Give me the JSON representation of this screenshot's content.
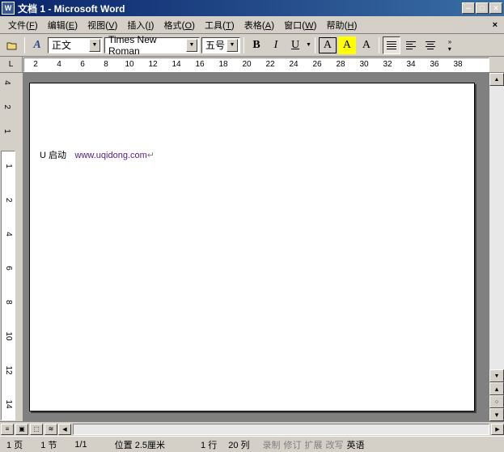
{
  "titlebar": {
    "icon": "W",
    "text": "文档 1 - Microsoft Word"
  },
  "menu": {
    "items": [
      {
        "label": "文件",
        "access": "F"
      },
      {
        "label": "编辑",
        "access": "E"
      },
      {
        "label": "视图",
        "access": "V"
      },
      {
        "label": "插入",
        "access": "I"
      },
      {
        "label": "格式",
        "access": "O"
      },
      {
        "label": "工具",
        "access": "T"
      },
      {
        "label": "表格",
        "access": "A"
      },
      {
        "label": "窗口",
        "access": "W"
      },
      {
        "label": "帮助",
        "access": "H"
      }
    ],
    "close": "×"
  },
  "toolbar": {
    "style_icon": "A",
    "style": "正文",
    "font": "Times New Roman",
    "size": "五号",
    "bold": "B",
    "italic": "I",
    "underline": "U",
    "box_a": "A",
    "hl_a": "A",
    "plain_a": "A"
  },
  "ruler": {
    "h": [
      "2",
      "4",
      "6",
      "8",
      "10",
      "12",
      "14",
      "16",
      "18",
      "20",
      "22",
      "24",
      "26",
      "28",
      "30",
      "32",
      "34",
      "36",
      "38"
    ],
    "v_top": [
      "4",
      "2",
      "1"
    ],
    "v_main": [
      "1",
      "2",
      "4",
      "6",
      "8",
      "10",
      "12",
      "14"
    ]
  },
  "document": {
    "text1": "U 启动",
    "text2": "www.uqidong.com",
    "para": "↵"
  },
  "views": [
    "≡",
    "▣",
    "⬚",
    "≋"
  ],
  "status": {
    "page": "1 页",
    "sec": "1 节",
    "pages": "1/1",
    "pos": "位置 2.5厘米",
    "line": "1 行",
    "col": "20 列",
    "rec": "录制",
    "rev": "修订",
    "ext": "扩展",
    "ovr": "改写",
    "lang": "英语"
  }
}
